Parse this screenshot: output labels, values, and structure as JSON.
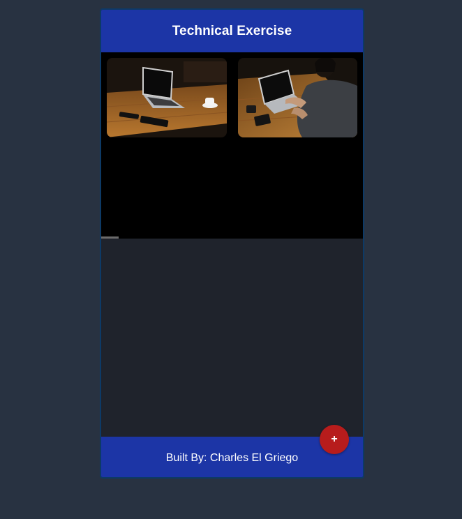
{
  "header": {
    "title": "Technical Exercise"
  },
  "gallery": {
    "images": [
      {
        "name": "laptop-on-table-photo"
      },
      {
        "name": "person-typing-laptop-photo"
      }
    ],
    "scroll_progress": 0.07
  },
  "footer": {
    "text": "Built By: Charles El Griego"
  },
  "fab": {
    "label": "+",
    "icon": "plus-icon",
    "color": "#b71c1c"
  },
  "colors": {
    "background": "#283241",
    "header": "#1c35a6",
    "content": "#1f232c",
    "gallery": "#000000"
  }
}
